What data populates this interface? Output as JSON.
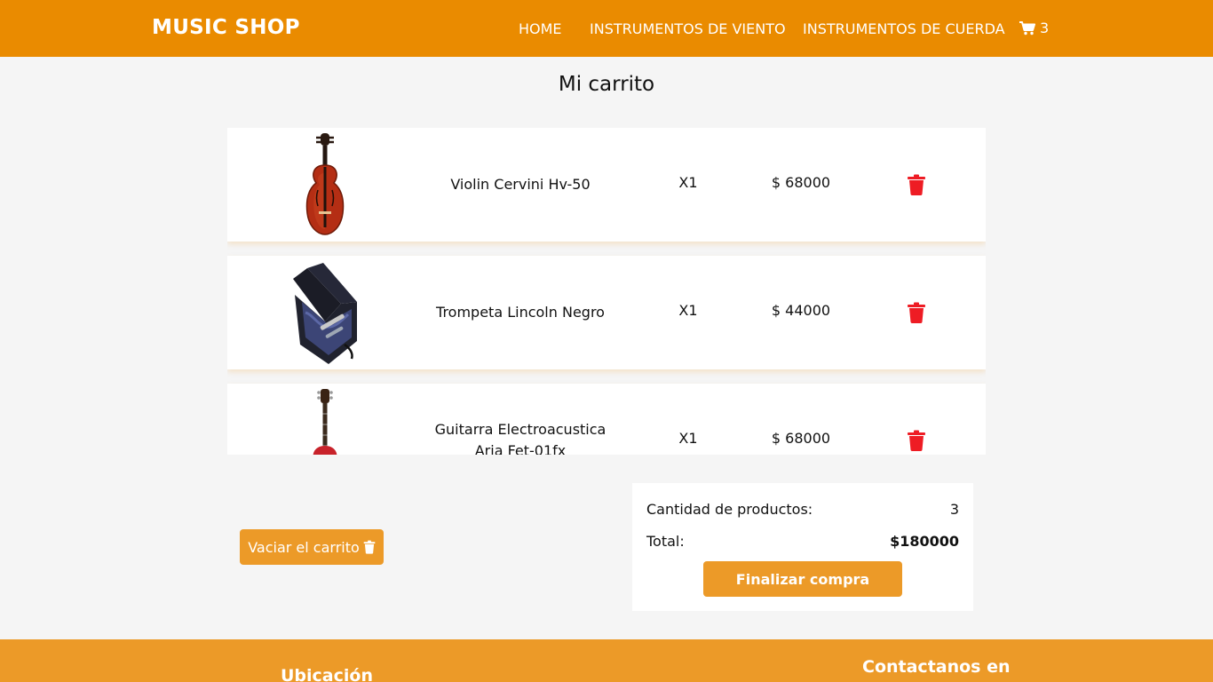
{
  "navbar": {
    "brand": "MUSIC SHOP",
    "links": [
      "HOME",
      "INSTRUMENTOS DE VIENTO",
      "INSTRUMENTOS DE CUERDA"
    ],
    "cart_count": "3",
    "cart_icon": "shopping-cart-icon"
  },
  "page": {
    "title": "Mi carrito"
  },
  "cart": {
    "items": [
      {
        "name": "Violin Cervini Hv-50",
        "qty": "X1",
        "price": "$ 68000",
        "image": "violin",
        "delete_icon": "trash-icon"
      },
      {
        "name": "Trompeta Lincoln Negro",
        "qty": "X1",
        "price": "$ 44000",
        "image": "trumpet-case",
        "delete_icon": "trash-icon"
      },
      {
        "name": "Guitarra Electroacustica Aria Fet-01fx",
        "qty": "X1",
        "price": "$ 68000",
        "image": "guitar",
        "delete_icon": "trash-icon"
      }
    ]
  },
  "actions": {
    "empty_label": "Vaciar el carrito"
  },
  "summary": {
    "count_label": "Cantidad de productos:",
    "count_value": "3",
    "total_label": "Total:",
    "total_value": "$180000",
    "finish_label": "Finalizar compra"
  },
  "footer": {
    "location": "Ubicación",
    "contact": "Contactanos en"
  },
  "colors": {
    "primary": "#ea8b00",
    "button": "#ec9a28",
    "delete": "#ee1c24",
    "background": "#f5f5f5"
  }
}
